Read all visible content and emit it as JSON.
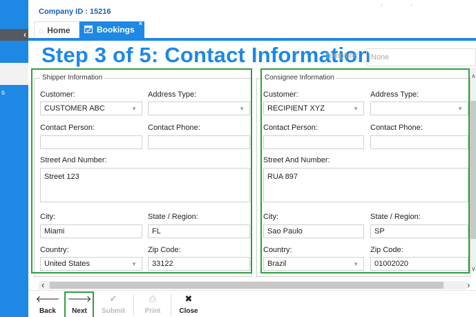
{
  "header": {
    "company_id": "Company ID : 15216",
    "tabs": [
      {
        "label": "Home",
        "icon": "home-icon"
      },
      {
        "label": "Bookings",
        "icon": "calendar-icon"
      }
    ],
    "tab_close": "×",
    "collapse_glyph": "‹",
    "sidebar_label": "s"
  },
  "page": {
    "title": "Step 3 of 5: Contact Information",
    "template_label": "Template:",
    "template_value": "None"
  },
  "shipper": {
    "legend": "Shipper Information",
    "customer_label": "Customer:",
    "customer_value": "CUSTOMER ABC",
    "address_type_label": "Address Type:",
    "address_type_value": "",
    "contact_person_label": "Contact Person:",
    "contact_person_value": "",
    "contact_phone_label": "Contact Phone:",
    "contact_phone_value": "",
    "street_label": "Street And Number:",
    "street_value": "Street 123",
    "city_label": "City:",
    "city_value": "Miami",
    "state_label": "State / Region:",
    "state_value": "FL",
    "country_label": "Country:",
    "country_value": "United States",
    "zip_label": "Zip Code:",
    "zip_value": "33122"
  },
  "consignee": {
    "legend": "Consignee Information",
    "customer_label": "Customer:",
    "customer_value": "RECIPIENT XYZ",
    "address_type_label": "Address Type:",
    "address_type_value": "",
    "contact_person_label": "Contact Person:",
    "contact_person_value": "",
    "contact_phone_label": "Contact Phone:",
    "contact_phone_value": "",
    "street_label": "Street And Number:",
    "street_value": "RUA 897",
    "city_label": "City:",
    "city_value": "Sao Paulo",
    "state_label": "State / Region:",
    "state_value": "SP",
    "country_label": "Country:",
    "country_value": "Brazil",
    "zip_label": "Zip Code:",
    "zip_value": "01002020"
  },
  "toolbar": {
    "back": "Back",
    "next": "Next",
    "submit": "Submit",
    "print": "Print",
    "close": "Close"
  },
  "colors": {
    "accent": "#1e88e5",
    "highlight": "#2e9e3e",
    "sidebar_dark": "#555a60"
  }
}
